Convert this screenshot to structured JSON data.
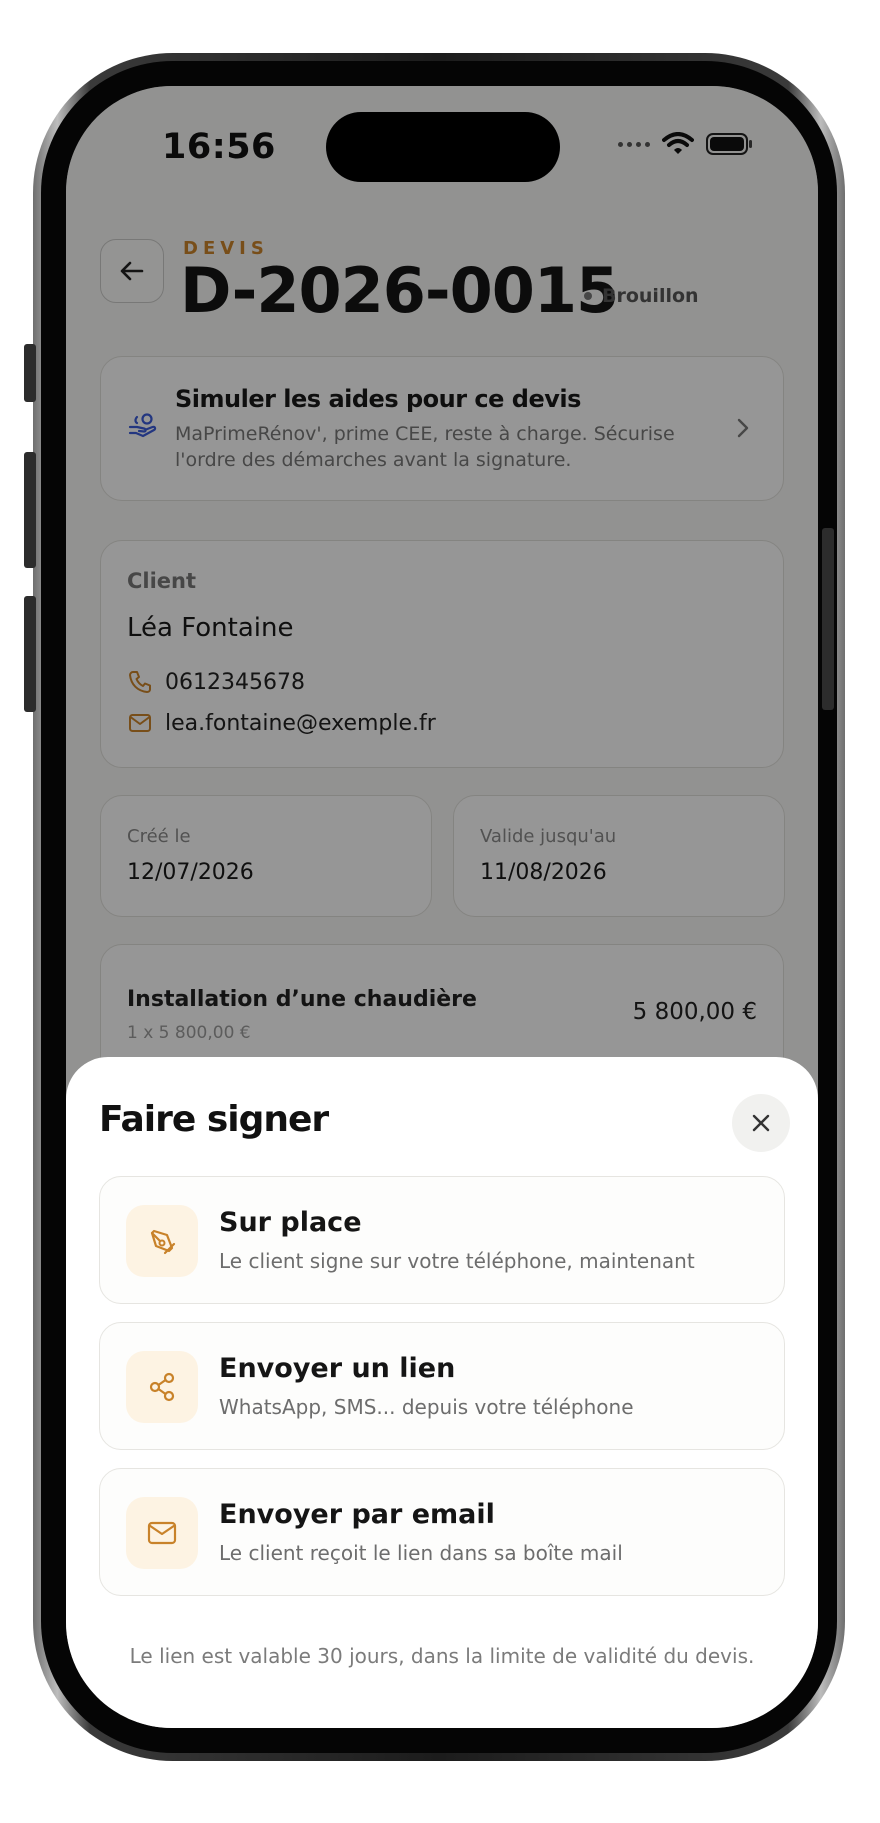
{
  "status_bar": {
    "time": "16:56"
  },
  "header": {
    "eyebrow": "DEVIS",
    "title": "D-2026-0015",
    "status": "Brouillon"
  },
  "aid_card": {
    "title": "Simuler les aides pour ce devis",
    "description": "MaPrimeRénov', prime CEE, reste à charge. Sécurise l'ordre des démarches avant la signature."
  },
  "client": {
    "label": "Client",
    "name": "Léa Fontaine",
    "phone": "0612345678",
    "email": "lea.fontaine@exemple.fr"
  },
  "dates": {
    "created_label": "Créé le",
    "created_value": "12/07/2026",
    "valid_label": "Valide jusqu'au",
    "valid_value": "11/08/2026"
  },
  "line_item": {
    "title": "Installation d’une chaudière",
    "quantity": "1 x 5 800,00 €",
    "total": "5 800,00 €"
  },
  "sheet": {
    "title": "Faire signer",
    "options": [
      {
        "title": "Sur place",
        "description": "Le client signe sur votre téléphone, maintenant",
        "icon": "pen-tool-icon"
      },
      {
        "title": "Envoyer un lien",
        "description": "WhatsApp, SMS... depuis votre téléphone",
        "icon": "share-icon"
      },
      {
        "title": "Envoyer par email",
        "description": "Le client reçoit le lien dans sa boîte mail",
        "icon": "mail-icon"
      }
    ],
    "note": "Le lien est valable 30 jours, dans la limite de validité du devis."
  },
  "colors": {
    "accent": "#c8822a",
    "accent_bg": "#fdf3e3",
    "aid_icon": "#3b5bd6"
  }
}
